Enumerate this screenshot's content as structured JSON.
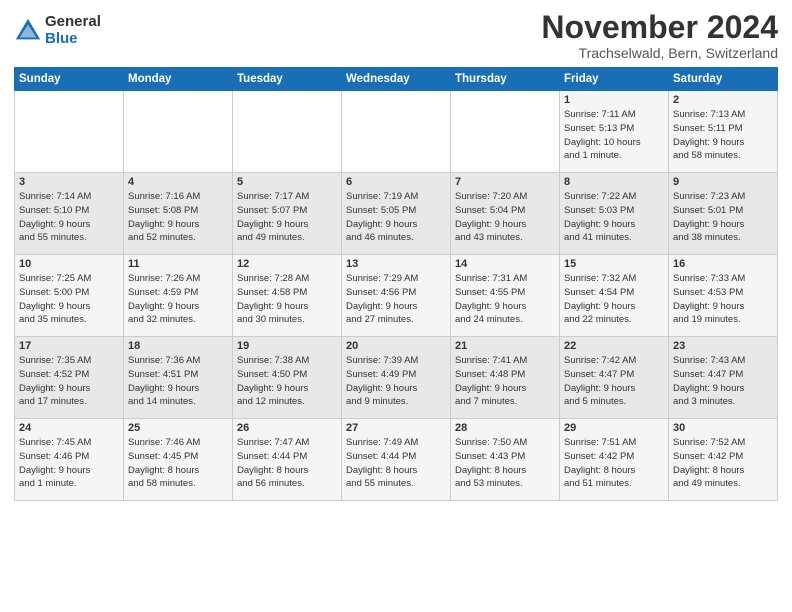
{
  "logo": {
    "general": "General",
    "blue": "Blue"
  },
  "header": {
    "title": "November 2024",
    "location": "Trachselwald, Bern, Switzerland"
  },
  "weekdays": [
    "Sunday",
    "Monday",
    "Tuesday",
    "Wednesday",
    "Thursday",
    "Friday",
    "Saturday"
  ],
  "weeks": [
    [
      {
        "day": "",
        "info": ""
      },
      {
        "day": "",
        "info": ""
      },
      {
        "day": "",
        "info": ""
      },
      {
        "day": "",
        "info": ""
      },
      {
        "day": "",
        "info": ""
      },
      {
        "day": "1",
        "info": "Sunrise: 7:11 AM\nSunset: 5:13 PM\nDaylight: 10 hours\nand 1 minute."
      },
      {
        "day": "2",
        "info": "Sunrise: 7:13 AM\nSunset: 5:11 PM\nDaylight: 9 hours\nand 58 minutes."
      }
    ],
    [
      {
        "day": "3",
        "info": "Sunrise: 7:14 AM\nSunset: 5:10 PM\nDaylight: 9 hours\nand 55 minutes."
      },
      {
        "day": "4",
        "info": "Sunrise: 7:16 AM\nSunset: 5:08 PM\nDaylight: 9 hours\nand 52 minutes."
      },
      {
        "day": "5",
        "info": "Sunrise: 7:17 AM\nSunset: 5:07 PM\nDaylight: 9 hours\nand 49 minutes."
      },
      {
        "day": "6",
        "info": "Sunrise: 7:19 AM\nSunset: 5:05 PM\nDaylight: 9 hours\nand 46 minutes."
      },
      {
        "day": "7",
        "info": "Sunrise: 7:20 AM\nSunset: 5:04 PM\nDaylight: 9 hours\nand 43 minutes."
      },
      {
        "day": "8",
        "info": "Sunrise: 7:22 AM\nSunset: 5:03 PM\nDaylight: 9 hours\nand 41 minutes."
      },
      {
        "day": "9",
        "info": "Sunrise: 7:23 AM\nSunset: 5:01 PM\nDaylight: 9 hours\nand 38 minutes."
      }
    ],
    [
      {
        "day": "10",
        "info": "Sunrise: 7:25 AM\nSunset: 5:00 PM\nDaylight: 9 hours\nand 35 minutes."
      },
      {
        "day": "11",
        "info": "Sunrise: 7:26 AM\nSunset: 4:59 PM\nDaylight: 9 hours\nand 32 minutes."
      },
      {
        "day": "12",
        "info": "Sunrise: 7:28 AM\nSunset: 4:58 PM\nDaylight: 9 hours\nand 30 minutes."
      },
      {
        "day": "13",
        "info": "Sunrise: 7:29 AM\nSunset: 4:56 PM\nDaylight: 9 hours\nand 27 minutes."
      },
      {
        "day": "14",
        "info": "Sunrise: 7:31 AM\nSunset: 4:55 PM\nDaylight: 9 hours\nand 24 minutes."
      },
      {
        "day": "15",
        "info": "Sunrise: 7:32 AM\nSunset: 4:54 PM\nDaylight: 9 hours\nand 22 minutes."
      },
      {
        "day": "16",
        "info": "Sunrise: 7:33 AM\nSunset: 4:53 PM\nDaylight: 9 hours\nand 19 minutes."
      }
    ],
    [
      {
        "day": "17",
        "info": "Sunrise: 7:35 AM\nSunset: 4:52 PM\nDaylight: 9 hours\nand 17 minutes."
      },
      {
        "day": "18",
        "info": "Sunrise: 7:36 AM\nSunset: 4:51 PM\nDaylight: 9 hours\nand 14 minutes."
      },
      {
        "day": "19",
        "info": "Sunrise: 7:38 AM\nSunset: 4:50 PM\nDaylight: 9 hours\nand 12 minutes."
      },
      {
        "day": "20",
        "info": "Sunrise: 7:39 AM\nSunset: 4:49 PM\nDaylight: 9 hours\nand 9 minutes."
      },
      {
        "day": "21",
        "info": "Sunrise: 7:41 AM\nSunset: 4:48 PM\nDaylight: 9 hours\nand 7 minutes."
      },
      {
        "day": "22",
        "info": "Sunrise: 7:42 AM\nSunset: 4:47 PM\nDaylight: 9 hours\nand 5 minutes."
      },
      {
        "day": "23",
        "info": "Sunrise: 7:43 AM\nSunset: 4:47 PM\nDaylight: 9 hours\nand 3 minutes."
      }
    ],
    [
      {
        "day": "24",
        "info": "Sunrise: 7:45 AM\nSunset: 4:46 PM\nDaylight: 9 hours\nand 1 minute."
      },
      {
        "day": "25",
        "info": "Sunrise: 7:46 AM\nSunset: 4:45 PM\nDaylight: 8 hours\nand 58 minutes."
      },
      {
        "day": "26",
        "info": "Sunrise: 7:47 AM\nSunset: 4:44 PM\nDaylight: 8 hours\nand 56 minutes."
      },
      {
        "day": "27",
        "info": "Sunrise: 7:49 AM\nSunset: 4:44 PM\nDaylight: 8 hours\nand 55 minutes."
      },
      {
        "day": "28",
        "info": "Sunrise: 7:50 AM\nSunset: 4:43 PM\nDaylight: 8 hours\nand 53 minutes."
      },
      {
        "day": "29",
        "info": "Sunrise: 7:51 AM\nSunset: 4:42 PM\nDaylight: 8 hours\nand 51 minutes."
      },
      {
        "day": "30",
        "info": "Sunrise: 7:52 AM\nSunset: 4:42 PM\nDaylight: 8 hours\nand 49 minutes."
      }
    ]
  ]
}
